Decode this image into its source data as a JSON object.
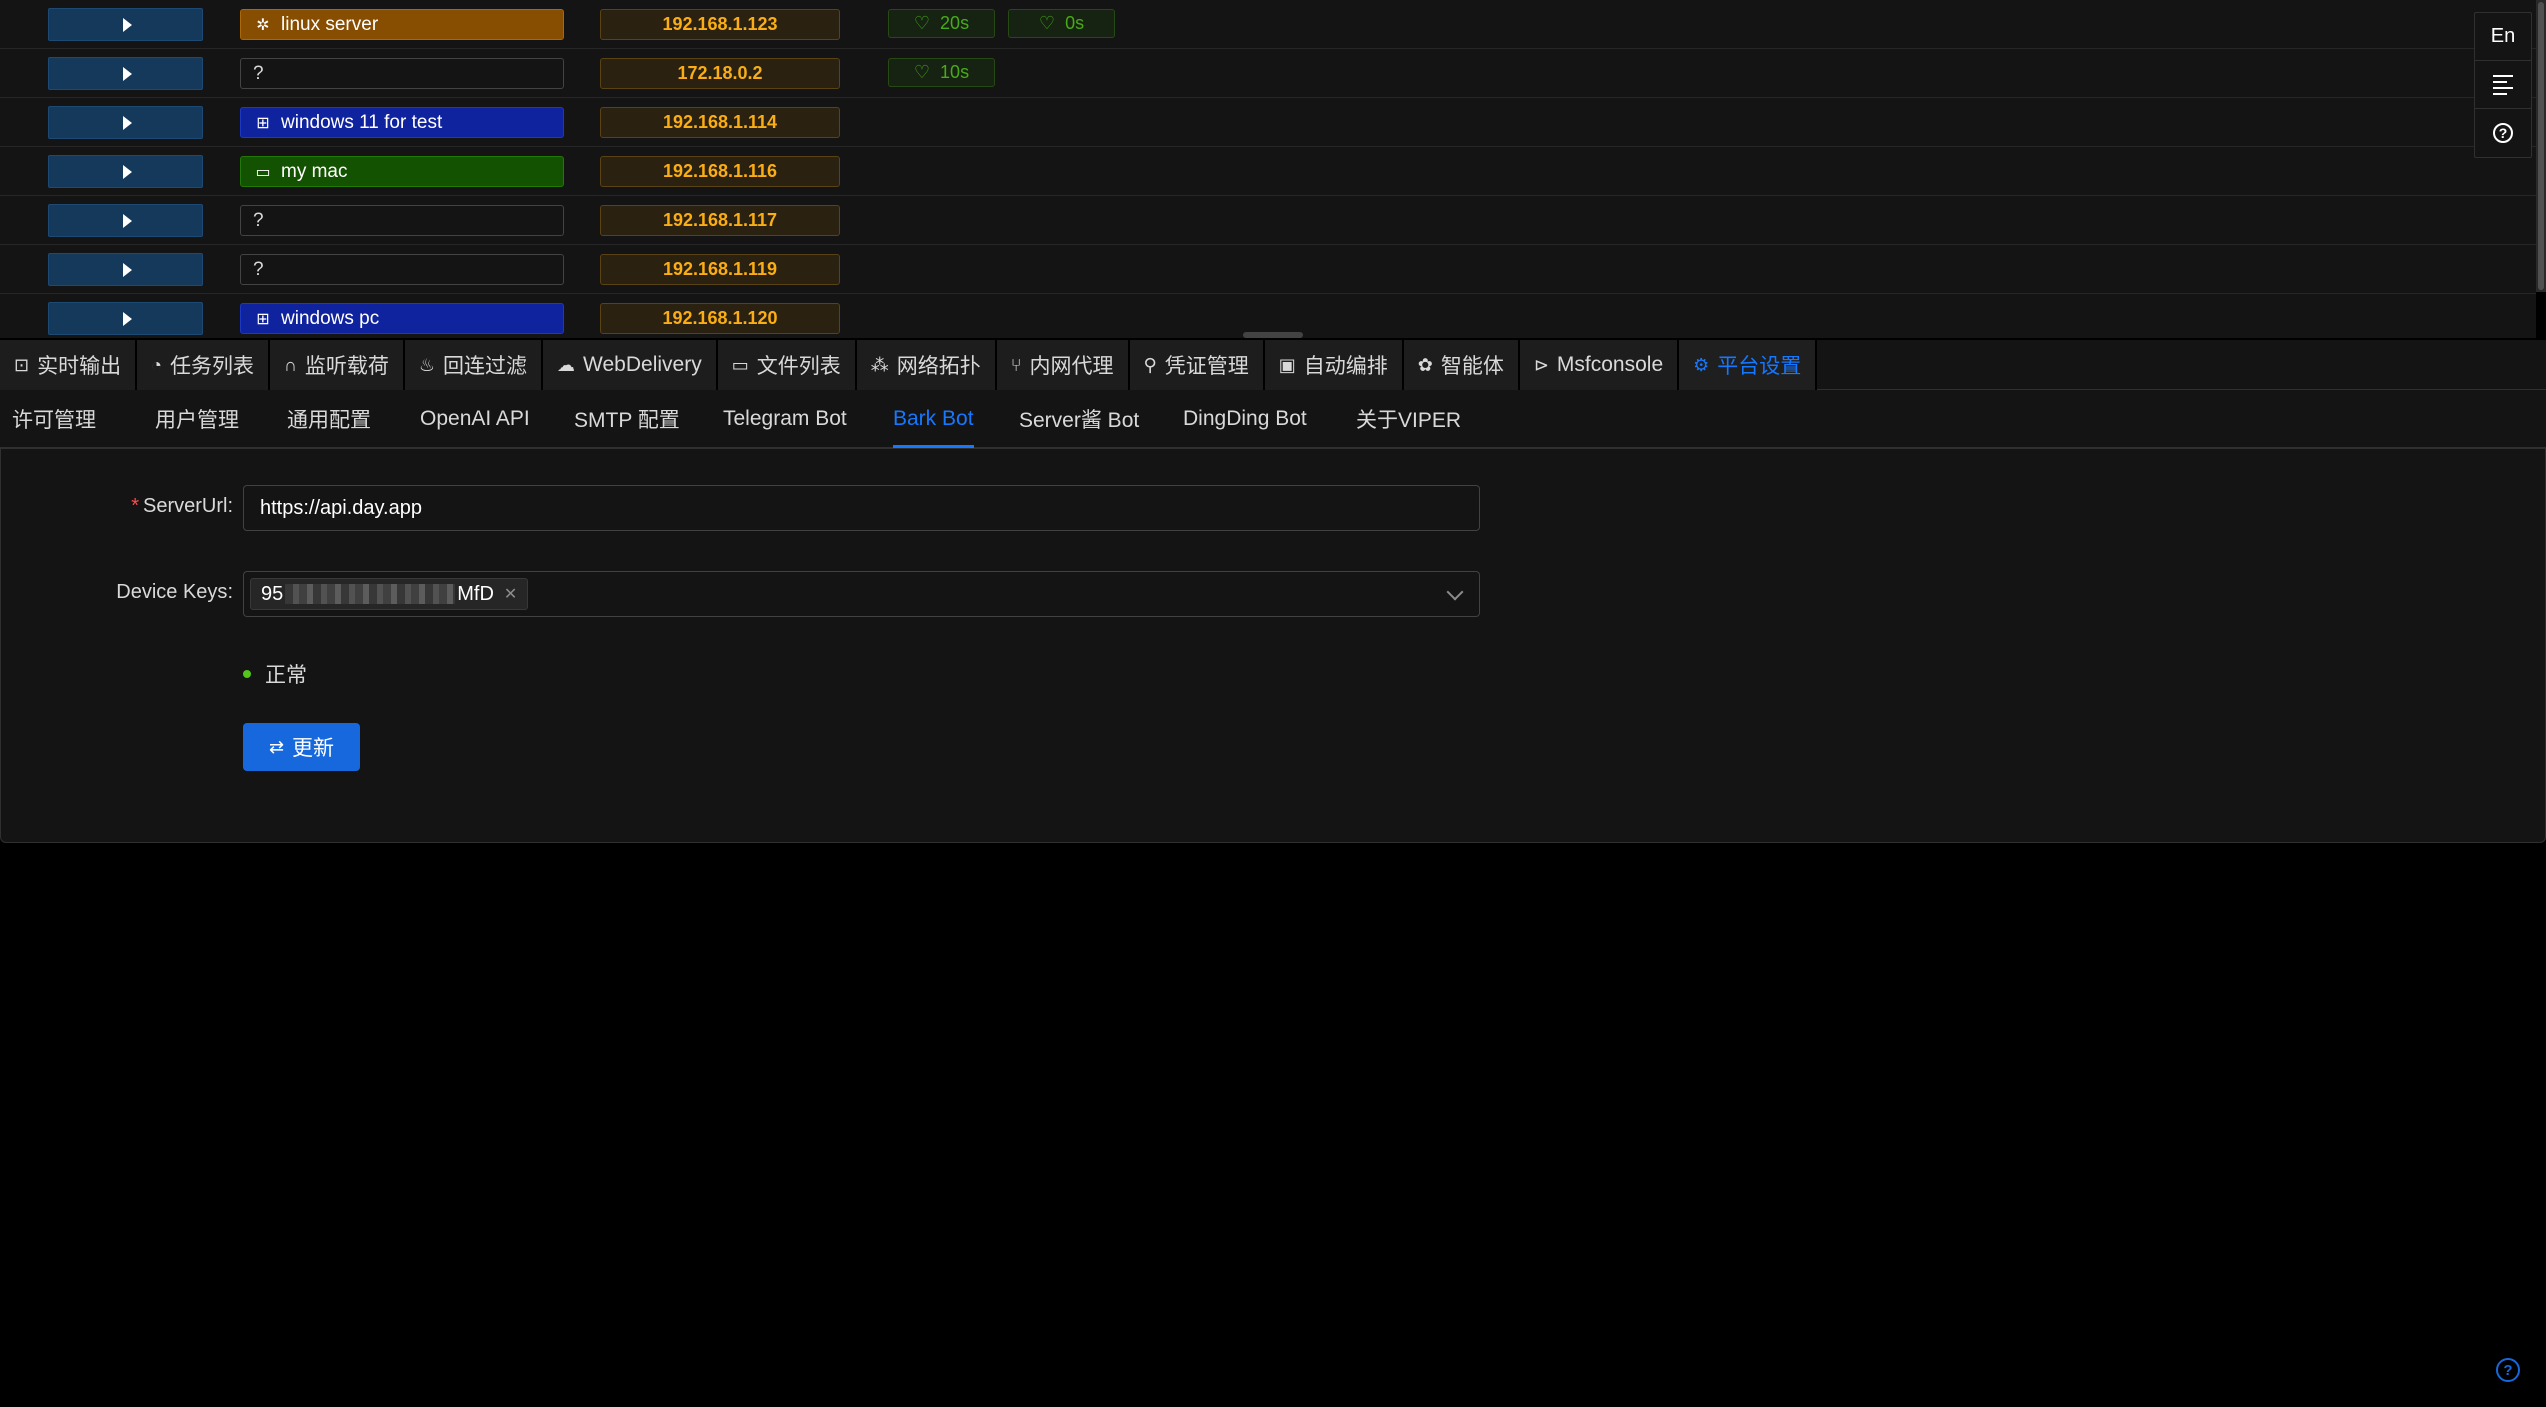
{
  "hosts": [
    {
      "name": "linux server",
      "icon": "bug-icon",
      "os": "linux",
      "ip": "192.168.1.123",
      "heartbeats": [
        "20s",
        "0s"
      ]
    },
    {
      "name": "?",
      "icon": "",
      "os": "unknown",
      "ip": "172.18.0.2",
      "heartbeats": [
        "10s"
      ]
    },
    {
      "name": "windows 11 for test",
      "icon": "windows-icon",
      "os": "windows",
      "ip": "192.168.1.114",
      "heartbeats": []
    },
    {
      "name": "my mac",
      "icon": "laptop-icon",
      "os": "mac",
      "ip": "192.168.1.116",
      "heartbeats": []
    },
    {
      "name": "?",
      "icon": "",
      "os": "unknown",
      "ip": "192.168.1.117",
      "heartbeats": []
    },
    {
      "name": "?",
      "icon": "",
      "os": "unknown",
      "ip": "192.168.1.119",
      "heartbeats": []
    },
    {
      "name": "windows pc",
      "icon": "windows-icon",
      "os": "windows",
      "ip": "192.168.1.120",
      "heartbeats": []
    }
  ],
  "side_buttons": {
    "lang": "En"
  },
  "main_tabs": [
    {
      "label": "实时输出",
      "icon": "monitor-icon",
      "glyph": "⊡"
    },
    {
      "label": "任务列表",
      "icon": "clock-icon",
      "glyph": "◔"
    },
    {
      "label": "监听载荷",
      "icon": "headphones-icon",
      "glyph": "∩"
    },
    {
      "label": "回连过滤",
      "icon": "fire-icon",
      "glyph": "♨"
    },
    {
      "label": "WebDelivery",
      "icon": "cloud-upload-icon",
      "glyph": "☁"
    },
    {
      "label": "文件列表",
      "icon": "folder-open-icon",
      "glyph": "▭"
    },
    {
      "label": "网络拓扑",
      "icon": "topology-icon",
      "glyph": "⁂"
    },
    {
      "label": "内网代理",
      "icon": "fork-icon",
      "glyph": "⑂"
    },
    {
      "label": "凭证管理",
      "icon": "key-search-icon",
      "glyph": "⚲"
    },
    {
      "label": "自动编排",
      "icon": "robot-icon",
      "glyph": "▣"
    },
    {
      "label": "智能体",
      "icon": "openai-icon",
      "glyph": "✿"
    },
    {
      "label": "Msfconsole",
      "icon": "terminal-icon",
      "glyph": "⊳"
    },
    {
      "label": "平台设置",
      "icon": "gear-icon",
      "glyph": "⚙",
      "active": true
    }
  ],
  "sub_tabs": [
    {
      "label": "许可管理"
    },
    {
      "label": "用户管理"
    },
    {
      "label": "通用配置"
    },
    {
      "label": "OpenAI API"
    },
    {
      "label": "SMTP 配置"
    },
    {
      "label": "Telegram Bot"
    },
    {
      "label": "Bark Bot",
      "active": true
    },
    {
      "label": "Server酱 Bot"
    },
    {
      "label": "DingDing Bot"
    },
    {
      "label": "关于VIPER"
    }
  ],
  "form": {
    "server_url_label": "ServerUrl",
    "server_url_value": "https://api.day.app",
    "device_keys_label": "Device Keys",
    "device_key_prefix": "95",
    "device_key_suffix": "MfD",
    "status_text": "正常",
    "update_label": "更新"
  },
  "colors": {
    "accent": "#1677ff",
    "ip_text": "#faad14",
    "heartbeat": "#49aa19",
    "linux_tag": "#874d00",
    "windows_tag": "#10239e",
    "mac_tag": "#135200"
  }
}
